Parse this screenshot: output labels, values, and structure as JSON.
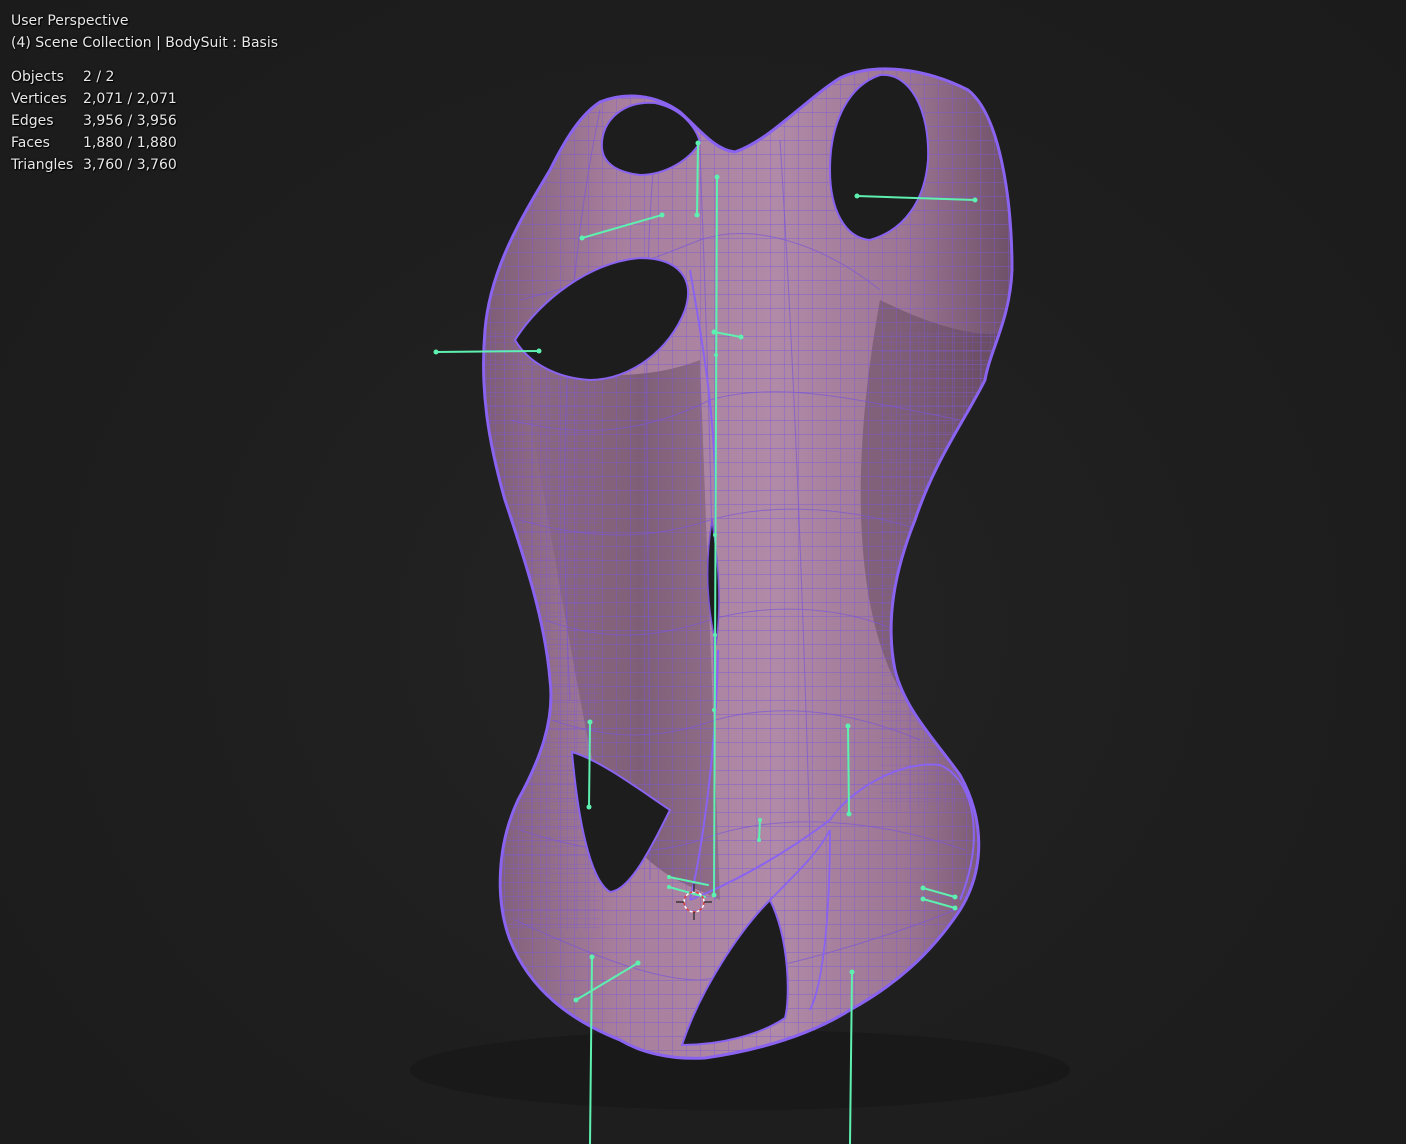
{
  "viewport": {
    "view_name": "User Perspective",
    "context": "(4) Scene Collection | BodySuit : Basis"
  },
  "statistics": [
    {
      "label": "Objects",
      "value": "2 / 2"
    },
    {
      "label": "Vertices",
      "value": "2,071 / 2,071"
    },
    {
      "label": "Edges",
      "value": "3,956 / 3,956"
    },
    {
      "label": "Faces",
      "value": "1,880 / 1,880"
    },
    {
      "label": "Triangles",
      "value": "3,760 / 3,760"
    }
  ],
  "colors": {
    "background": "#1d1d1d",
    "mesh_fill": "#a77e9c",
    "mesh_shadow": "#5c4357",
    "wire": "#7b57d6",
    "outline": "#8a63f0",
    "bones": "#5ef0b0",
    "cursor": "#e04040"
  },
  "icons": [
    "3d-cursor-icon"
  ]
}
